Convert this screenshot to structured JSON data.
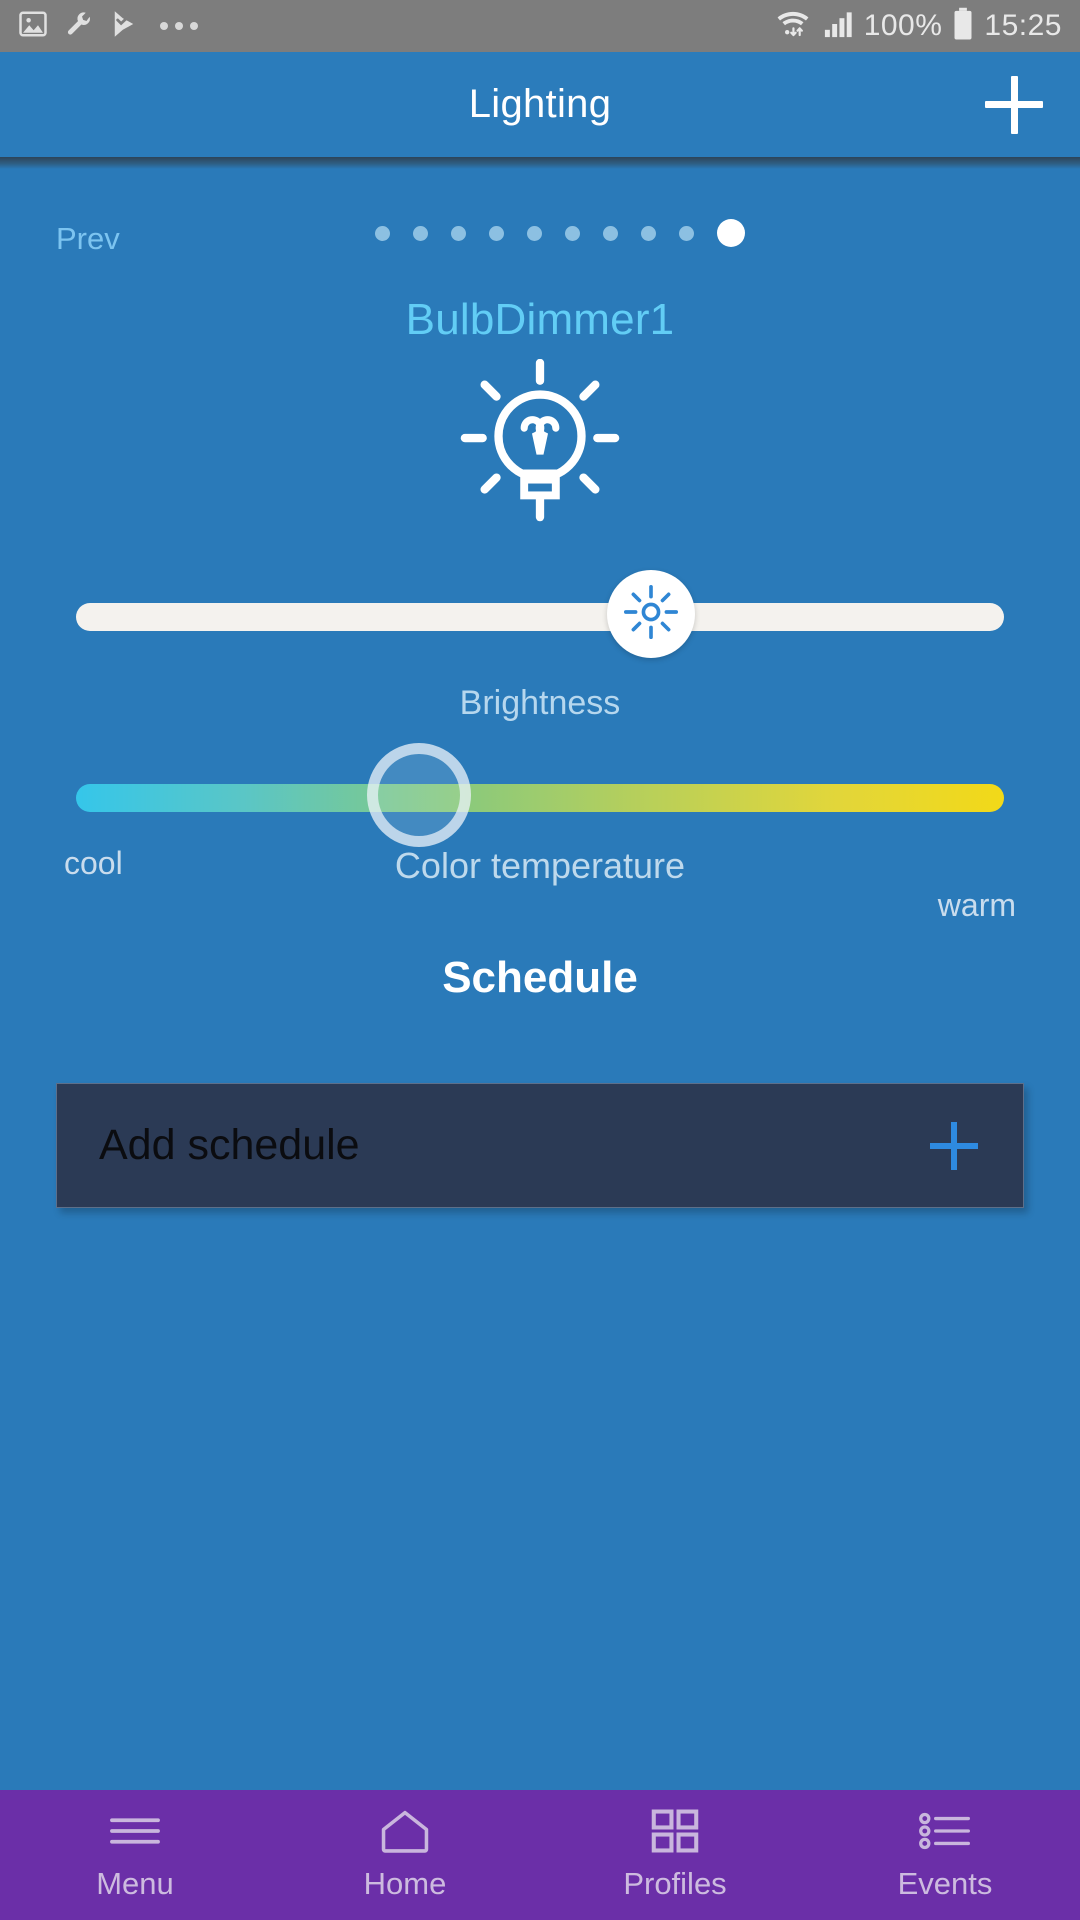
{
  "status_bar": {
    "icons_left": [
      "image-icon",
      "wrench-icon",
      "checkmark-flag-icon",
      "overflow-dots-icon"
    ],
    "icons_right": [
      "wifi-icon",
      "signal-icon",
      "battery-icon"
    ],
    "battery": "100%",
    "clock": "15:25",
    "background": "#7d7d7d"
  },
  "app_bar": {
    "title": "Lighting",
    "add_icon": "plus-icon",
    "background": "#2b7cbb"
  },
  "pager": {
    "prev_label": "Prev",
    "dot_count": 10,
    "active_index": 9
  },
  "device": {
    "name": "BulbDimmer1",
    "name_color": "#62cdf5",
    "icon": "light-bulb-icon"
  },
  "brightness": {
    "label": "Brightness",
    "value_percent": 62,
    "knob_icon": "brightness-sun-icon",
    "track_color": "#f4f2ee"
  },
  "color_temperature": {
    "label": "Color temperature",
    "min_label": "cool",
    "max_label": "warm",
    "value_percent": 37,
    "gradient_from": "#35c6ea",
    "gradient_mid": "#86c97f",
    "gradient_to": "#f2d918"
  },
  "schedule": {
    "heading": "Schedule",
    "add_label": "Add schedule",
    "add_icon": "plus-icon",
    "card_background": "#2b3a55",
    "plus_color": "#2e8ae0"
  },
  "bottom_nav": {
    "background": "#6b2fa8",
    "items": [
      {
        "label": "Menu",
        "icon": "hamburger-icon"
      },
      {
        "label": "Home",
        "icon": "home-icon"
      },
      {
        "label": "Profiles",
        "icon": "grid-squares-icon"
      },
      {
        "label": "Events",
        "icon": "bullet-list-icon"
      }
    ]
  }
}
